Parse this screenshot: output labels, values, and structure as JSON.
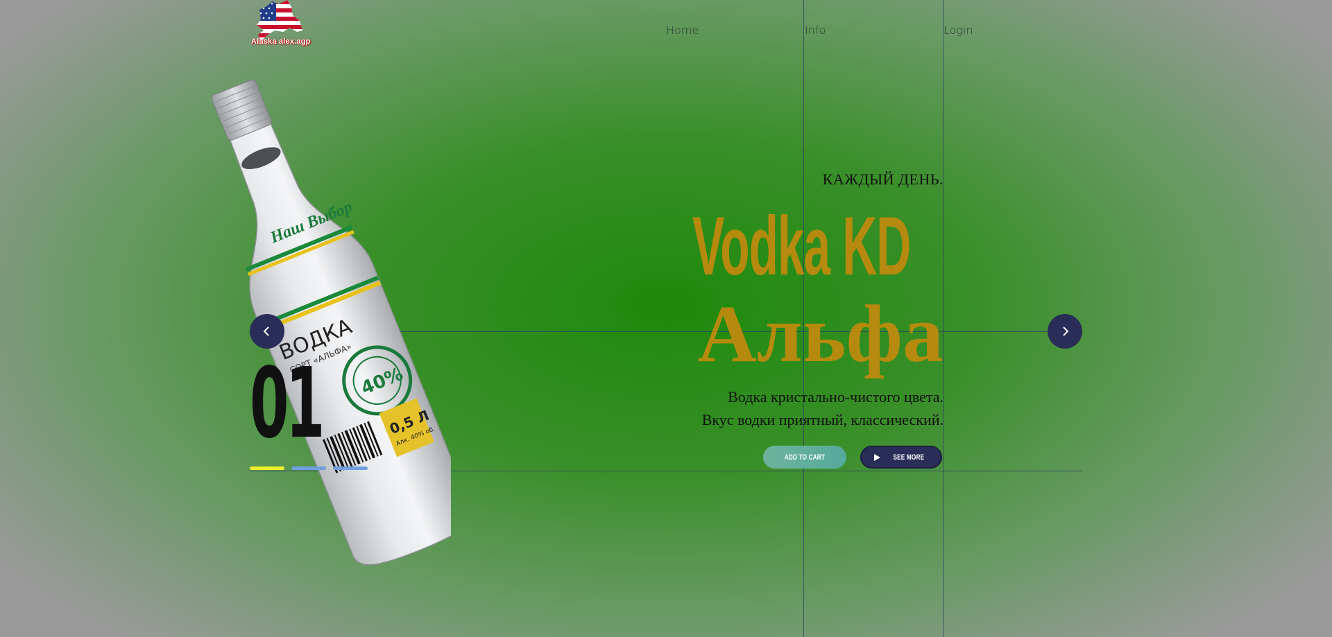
{
  "logo": {
    "text": "Alaska alex.agp"
  },
  "nav": {
    "items": [
      "Home",
      "Info",
      "Login"
    ]
  },
  "hero": {
    "tagline": "КАЖДЫЙ ДЕНЬ.",
    "title_line1": "Vodka KD",
    "title_line2": "Альфа",
    "description_line1": "Водка кристально-чистого цвета.",
    "description_line2": "Вкус водки приятный, классический.",
    "add_to_cart_label": "ADD TO CART",
    "see_more_label": "SEE MORE"
  },
  "slider": {
    "current_number": "01",
    "prev_icon": "chevron-left-icon",
    "next_icon": "chevron-right-icon",
    "indicator_colors": [
      "#f2ee2b",
      "#6f9fe0",
      "#6f9fe0"
    ]
  },
  "bottle_label": {
    "brand": "Наш Выбор",
    "product": "ВОДКА",
    "variety": "СОРТ «АЛЬФА»",
    "strength": "40%",
    "volume": "0,5 Л",
    "alc": "Алк. 40% об."
  },
  "colors": {
    "accent_gold": "#b58a0f",
    "button_navy": "#2a2d57",
    "button_teal": "#5fae9c"
  }
}
